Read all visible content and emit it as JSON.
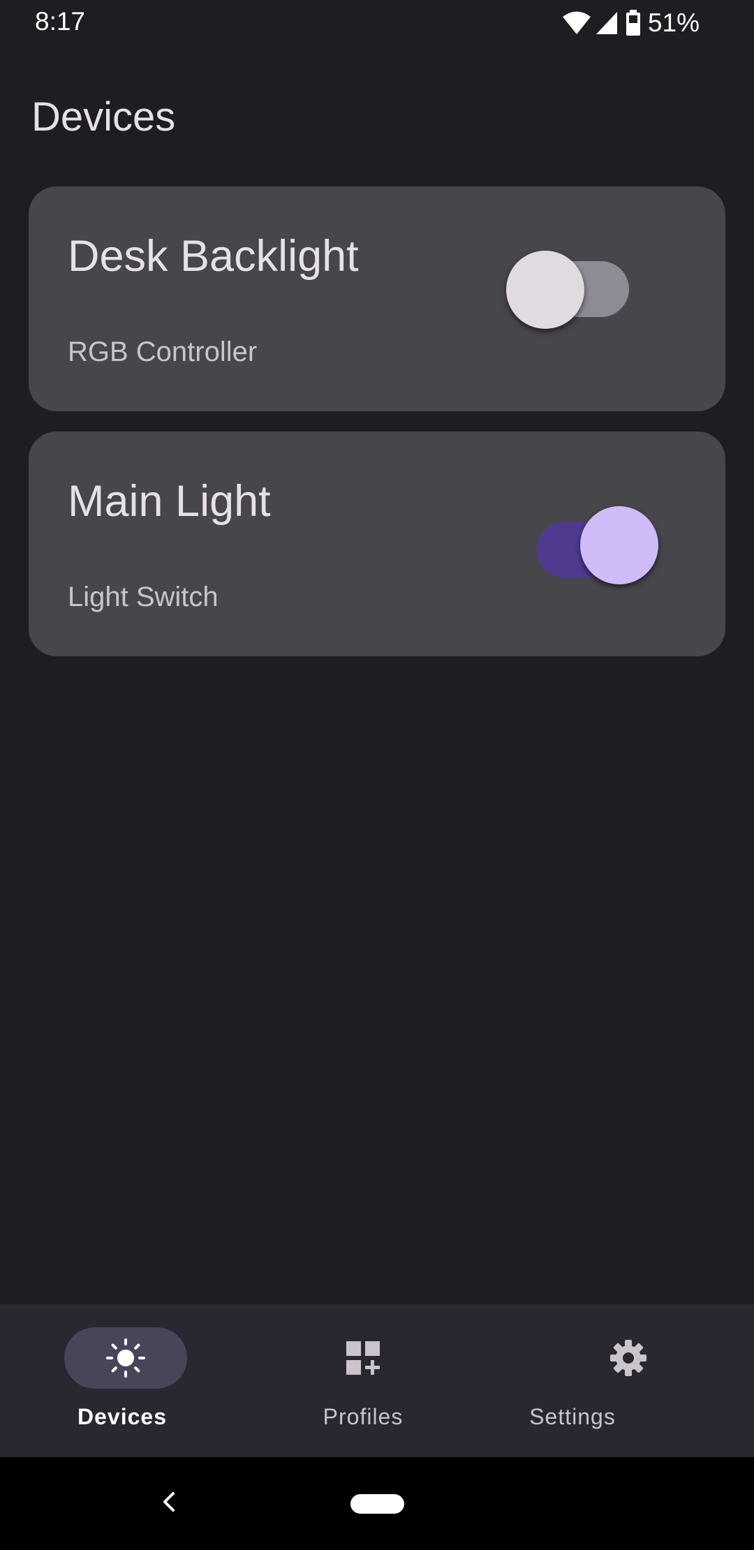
{
  "status_bar": {
    "time": "8:17",
    "battery_percent": "51%",
    "icons": [
      "wifi-icon",
      "cell-signal-icon",
      "battery-icon"
    ]
  },
  "page": {
    "title": "Devices"
  },
  "devices": [
    {
      "name": "Desk Backlight",
      "type": "RGB Controller",
      "enabled": false
    },
    {
      "name": "Main Light",
      "type": "Light Switch",
      "enabled": true
    }
  ],
  "bottom_nav": {
    "items": [
      {
        "label": "Devices",
        "icon": "sun-icon",
        "selected": true
      },
      {
        "label": "Profiles",
        "icon": "dashboard-add-icon",
        "selected": false
      },
      {
        "label": "Settings",
        "icon": "gear-icon",
        "selected": false
      }
    ]
  },
  "system_nav": {
    "icons": [
      "back-icon",
      "home-pill"
    ]
  },
  "colors": {
    "background": "#1e1d22",
    "card": "#47464a",
    "accent": "#cfbcf7",
    "accent_track": "#4f3a8f",
    "nav_background": "#29272f",
    "nav_indicator": "#4a4458"
  }
}
